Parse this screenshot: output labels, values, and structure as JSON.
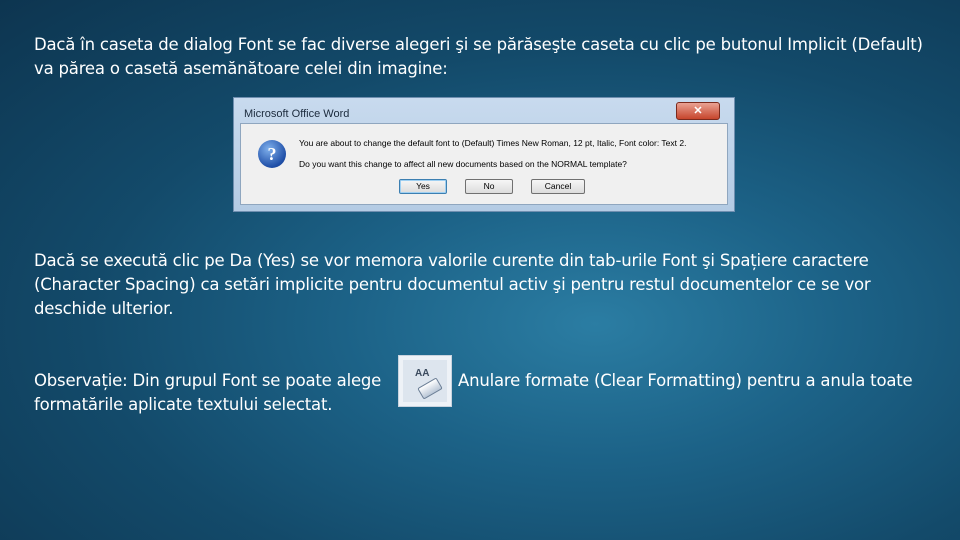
{
  "text": {
    "intro": "Dacă în caseta de dialog Font se fac diverse alegeri şi se părăseşte caseta cu clic pe butonul Implicit (Default) va părea o casetă asemănătoare celei din imagine:",
    "yes_explanation": "Dacă se execută clic pe Da (Yes) se vor memora valorile curente din tab-urile Font şi Spațiere caractere (Character Spacing) ca setări implicite pentru documentul activ şi pentru restul documentelor ce se vor deschide ulterior.",
    "observation_part1": "Observație: Din grupul Font se poate alege formatările aplicate textului selectat.",
    "observation_part2": "Anulare formate (Clear Formatting) pentru a anula toate"
  },
  "dialog": {
    "title": "Microsoft Office Word",
    "close_label": "✕",
    "icon_glyph": "?",
    "message1": "You are about to change the default font to (Default) Times New Roman, 12 pt, Italic, Font color: Text 2.",
    "message2": "Do you want this change to affect all new documents based on the NORMAL template?",
    "yes_label": "Yes",
    "no_label": "No",
    "cancel_label": "Cancel"
  },
  "clear_formatting_icon": {
    "icon": "clear-formatting-icon",
    "glyph": "AA"
  }
}
